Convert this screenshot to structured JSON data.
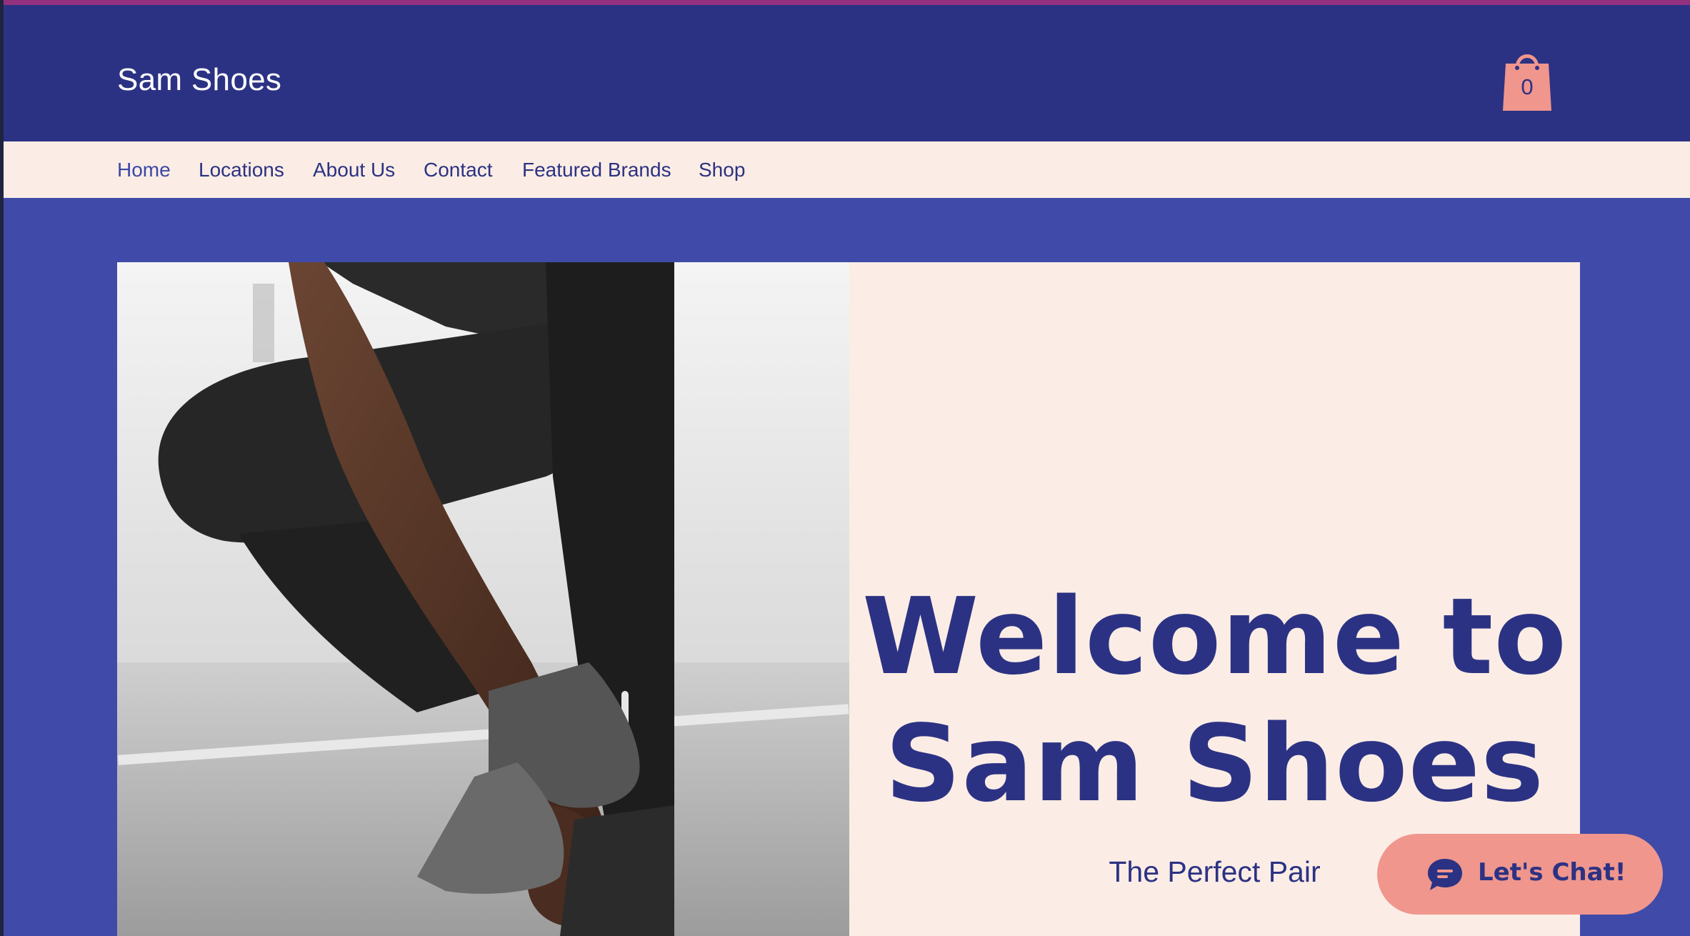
{
  "site": {
    "brand": "Sam Shoes",
    "cart_count": "0"
  },
  "nav": {
    "items": [
      {
        "label": "Home",
        "active": true
      },
      {
        "label": "Locations",
        "active": false
      },
      {
        "label": "About Us",
        "active": false
      },
      {
        "label": "Contact",
        "active": false
      },
      {
        "label": "Featured Brands",
        "active": false
      },
      {
        "label": "Shop",
        "active": false
      }
    ]
  },
  "hero": {
    "title_line1": "Welcome to",
    "title_line2": "Sam Shoes",
    "subtitle": "The Perfect Pair"
  },
  "chat": {
    "label": "Let's Chat!"
  },
  "colors": {
    "header_bg": "#2c3283",
    "nav_bg": "#fbede5",
    "page_bg": "#404aa8",
    "accent": "#f0968d",
    "text_dark": "#2c3283"
  },
  "icons": {
    "cart": "shopping-bag-icon",
    "chat": "chat-bubble-icon"
  }
}
